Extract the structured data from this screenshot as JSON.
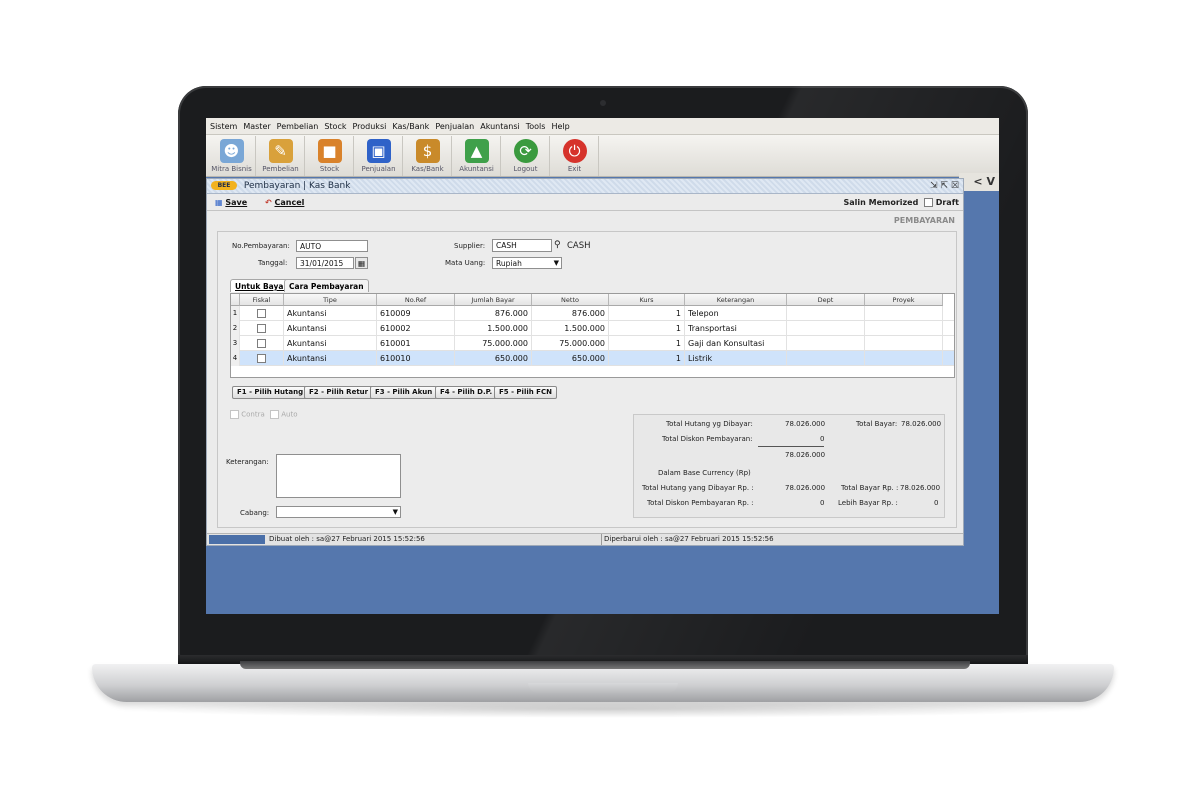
{
  "menu": [
    "Sistem",
    "Master",
    "Pembelian",
    "Stock",
    "Produksi",
    "Kas/Bank",
    "Penjualan",
    "Akuntansi",
    "Tools",
    "Help"
  ],
  "toolbar": [
    {
      "label": "Mitra Bisnis",
      "icon": "people-icon",
      "color": "#7aa7d6"
    },
    {
      "label": "Pembelian",
      "icon": "purchase-icon",
      "color": "#d9a13b"
    },
    {
      "label": "Stock",
      "icon": "box-icon",
      "color": "#d9822b"
    },
    {
      "label": "Penjualan",
      "icon": "bag-icon",
      "color": "#2f62c8"
    },
    {
      "label": "Kas/Bank",
      "icon": "money-bag-icon",
      "color": "#c98a2a"
    },
    {
      "label": "Akuntansi",
      "icon": "chart-icon",
      "color": "#3fa04a"
    },
    {
      "label": "Logout",
      "icon": "logout-icon",
      "color": "#3a9a3e"
    },
    {
      "label": "Exit",
      "icon": "power-icon",
      "color": "#d6332b"
    }
  ],
  "toolbar_right": "V",
  "window": {
    "logo": "BEE",
    "title": "Pembayaran | Kas Bank",
    "save_label": "Save",
    "cancel_label": "Cancel",
    "salin_label": "Salin Memorized",
    "draft_label": "Draft",
    "section_title": "PEMBAYARAN"
  },
  "form": {
    "no_pembayaran_label": "No.Pembayaran:",
    "no_pembayaran_value": "AUTO",
    "tanggal_label": "Tanggal:",
    "tanggal_value": "31/01/2015",
    "supplier_label": "Supplier:",
    "supplier_value": "CASH",
    "supplier_name": "CASH",
    "mata_uang_label": "Mata Uang:",
    "mata_uang_value": "Rupiah"
  },
  "tabs": [
    "Untuk Bayar",
    "Cara Pembayaran"
  ],
  "grid": {
    "columns": [
      "Fiskal",
      "Tipe",
      "No.Ref",
      "Jumlah Bayar",
      "Netto",
      "Kurs",
      "Keterangan",
      "Dept",
      "Proyek"
    ],
    "rows": [
      {
        "num": "1",
        "tipe": "Akuntansi",
        "ref": "610009",
        "jumlah": "876.000",
        "netto": "876.000",
        "kurs": "1",
        "ket": "Telepon"
      },
      {
        "num": "2",
        "tipe": "Akuntansi",
        "ref": "610002",
        "jumlah": "1.500.000",
        "netto": "1.500.000",
        "kurs": "1",
        "ket": "Transportasi"
      },
      {
        "num": "3",
        "tipe": "Akuntansi",
        "ref": "610001",
        "jumlah": "75.000.000",
        "netto": "75.000.000",
        "kurs": "1",
        "ket": "Gaji dan Konsultasi"
      },
      {
        "num": "4",
        "tipe": "Akuntansi",
        "ref": "610010",
        "jumlah": "650.000",
        "netto": "650.000",
        "kurs": "1",
        "ket": "Listrik"
      }
    ]
  },
  "fbuttons": [
    "F1 - Pilih Hutang",
    "F2 - Pilih Retur",
    "F3 - Pilih Akun",
    "F4 - Pilih D.P.",
    "F5 - Pilih FCN"
  ],
  "options": {
    "contra": "Contra",
    "auto": "Auto"
  },
  "keterangan_label": "Keterangan:",
  "cabang_label": "Cabang:",
  "totals": {
    "total_hutang_label": "Total Hutang yg Dibayar:",
    "total_hutang_value": "78.026.000",
    "total_bayar_label": "Total Bayar:",
    "total_bayar_value": "78.026.000",
    "total_diskon_label": "Total Diskon Pembayaran:",
    "total_diskon_value": "0",
    "subtotal_value": "78.026.000",
    "base_currency_label": "Dalam Base Currency (Rp)",
    "hutang_rp_label": "Total Hutang yang Dibayar Rp. :",
    "hutang_rp_value": "78.026.000",
    "bayar_rp_label": "Total Bayar Rp. :",
    "bayar_rp_value": "78.026.000",
    "diskon_rp_label": "Total Diskon Pembayaran Rp. :",
    "diskon_rp_value": "0",
    "lebih_label": "Lebih Bayar Rp. :",
    "lebih_value": "0"
  },
  "status": {
    "created": "Dibuat oleh : sa@27 Februari 2015  15:52:56",
    "updated": "Diperbarui oleh : sa@27 Februari 2015  15:52:56"
  }
}
